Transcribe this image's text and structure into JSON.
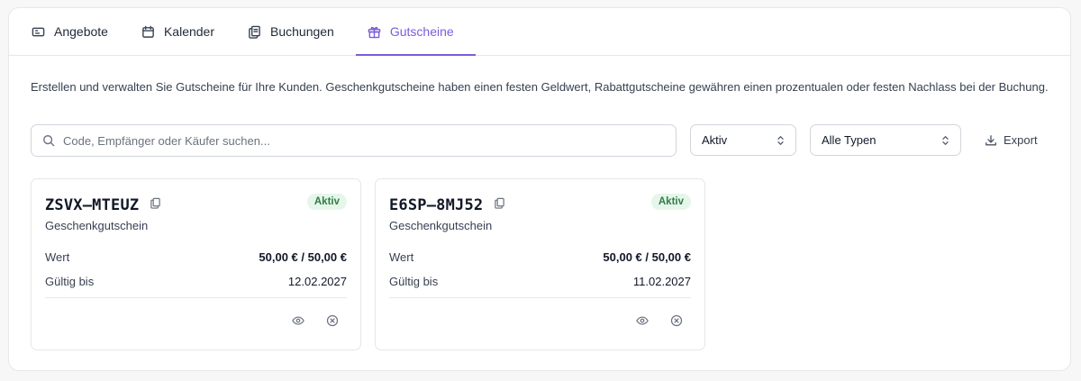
{
  "tabs": [
    {
      "label": "Angebote",
      "icon": "ticket-icon"
    },
    {
      "label": "Kalender",
      "icon": "calendar-icon"
    },
    {
      "label": "Buchungen",
      "icon": "copy-icon"
    },
    {
      "label": "Gutscheine",
      "icon": "gift-icon",
      "active": true
    }
  ],
  "description": "Erstellen und verwalten Sie Gutscheine für Ihre Kunden. Geschenkgutscheine haben einen festen Geldwert, Rabattgutscheine gewähren einen prozentualen oder festen Nachlass bei der Buchung.",
  "search": {
    "placeholder": "Code, Empfänger oder Käufer suchen...",
    "value": ""
  },
  "filters": {
    "status": "Aktiv",
    "type": "Alle Typen"
  },
  "export_label": "Export",
  "accent_color": "#7c5cdb",
  "vouchers": [
    {
      "code": "ZSVX–MTEUZ",
      "status": "Aktiv",
      "type": "Geschenkgutschein",
      "value_label": "Wert",
      "value": "50,00 € / 50,00 €",
      "valid_label": "Gültig bis",
      "valid_until": "12.02.2027"
    },
    {
      "code": "E6SP–8MJ52",
      "status": "Aktiv",
      "type": "Geschenkgutschein",
      "value_label": "Wert",
      "value": "50,00 € / 50,00 €",
      "valid_label": "Gültig bis",
      "valid_until": "11.02.2027"
    }
  ]
}
